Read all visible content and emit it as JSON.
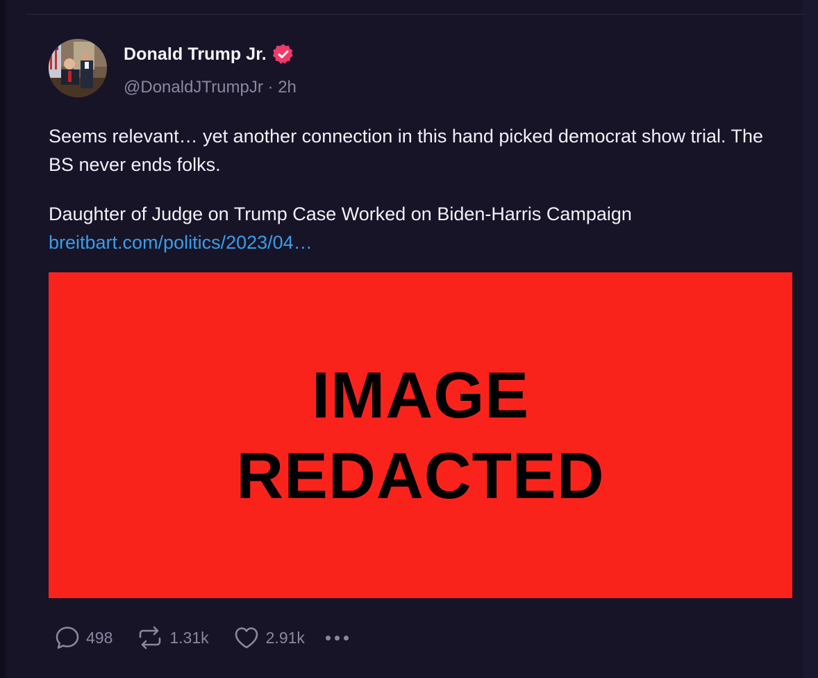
{
  "post": {
    "author": {
      "display_name": "Donald Trump Jr.",
      "handle": "@DonaldJTrumpJr",
      "separator": " · ",
      "time": "2h",
      "verified_icon": "verified-badge-icon",
      "verified_color": "#f03a68"
    },
    "text": {
      "paragraph1": "Seems relevant… yet another connection in this hand picked democrat show trial. The BS never ends folks.",
      "paragraph2": "Daughter of Judge on Trump Case Worked on Biden-Harris Campaign",
      "link": "breitbart.com/politics/2023/04…"
    },
    "media": {
      "line1": "IMAGE",
      "line2": "REDACTED",
      "background": "#fa231c"
    },
    "actions": {
      "replies": "498",
      "reposts": "1.31k",
      "likes": "2.91k",
      "reply_icon": "speech-bubble-icon",
      "repost_icon": "repost-arrows-icon",
      "like_icon": "heart-icon",
      "more_icon": "more-dots-icon"
    }
  },
  "colors": {
    "background": "#171428",
    "text": "#f2f1f7",
    "muted": "#8b879f",
    "link": "#3a9ee8"
  }
}
